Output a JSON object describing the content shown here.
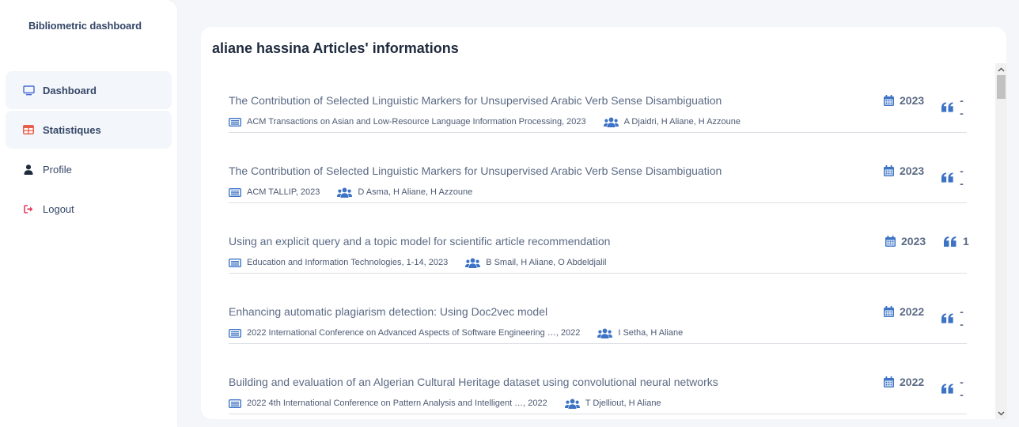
{
  "app": {
    "brand": "Bibliometric dashboard"
  },
  "sidebar": {
    "items": [
      {
        "label": "Dashboard",
        "icon": "monitor-icon",
        "active": true
      },
      {
        "label": "Statistiques",
        "icon": "table-icon",
        "active": true
      },
      {
        "label": "Profile",
        "icon": "user-icon",
        "active": false
      },
      {
        "label": "Logout",
        "icon": "logout-icon",
        "active": false
      }
    ]
  },
  "main": {
    "title": "aliane hassina Articles' informations",
    "articles": [
      {
        "title": "The Contribution of Selected Linguistic Markers for Unsupervised Arabic Verb Sense Disambiguation",
        "source": "ACM Transactions on Asian and Low-Resource Language Information Processing, 2023",
        "authors": "A Djaidri, H Aliane, H Azzoune",
        "year": "2023",
        "citations": "--"
      },
      {
        "title": "The Contribution of Selected Linguistic Markers for Unsupervised Arabic Verb Sense Disambiguation",
        "source": "ACM TALLIP, 2023",
        "authors": "D Asma, H Aliane, H Azzoune",
        "year": "2023",
        "citations": "--"
      },
      {
        "title": "Using an explicit query and a topic model for scientific article recommendation",
        "source": "Education and Information Technologies, 1-14, 2023",
        "authors": "B Smail, H Aliane, O Abdeldjalil",
        "year": "2023",
        "citations": "1"
      },
      {
        "title": "Enhancing automatic plagiarism detection: Using Doc2vec model",
        "source": "2022 International Conference on Advanced Aspects of Software Engineering …, 2022",
        "authors": "I Setha, H Aliane",
        "year": "2022",
        "citations": "--"
      },
      {
        "title": "Building and evaluation of an Algerian Cultural Heritage dataset using convolutional neural networks",
        "source": "2022 4th International Conference on Pattern Analysis and Intelligent …, 2022",
        "authors": "T Djelliout, H Aliane",
        "year": "2022",
        "citations": "--"
      }
    ]
  },
  "colors": {
    "accent": "#4a7fc8",
    "text": "#5b6a84",
    "heading": "#1f2a3d",
    "statistiques_icon": "#e8604c",
    "logout_icon": "#e03e5c"
  }
}
